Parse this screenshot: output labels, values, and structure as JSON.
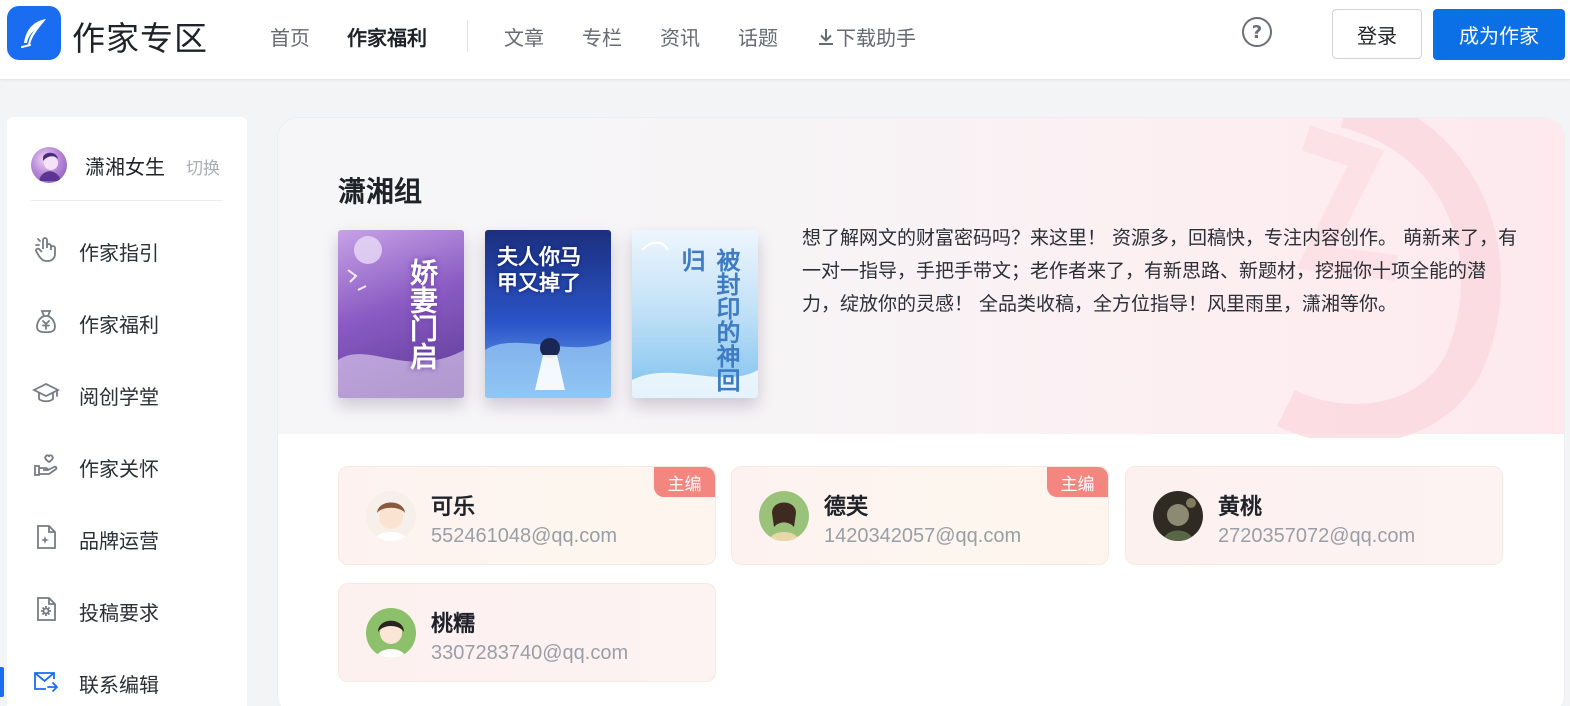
{
  "header": {
    "site_name": "作家专区",
    "nav": [
      {
        "label": "首页",
        "active": false
      },
      {
        "label": "作家福利",
        "active": true
      },
      {
        "label": "文章",
        "active": false
      },
      {
        "label": "专栏",
        "active": false
      },
      {
        "label": "资讯",
        "active": false
      },
      {
        "label": "话题",
        "active": false
      },
      {
        "label": "下载助手",
        "active": false
      }
    ],
    "help_symbol": "?",
    "login_label": "登录",
    "become_author_label": "成为作家"
  },
  "sidebar": {
    "channel_name": "潇湘女生",
    "switch_label": "切换",
    "items": [
      {
        "label": "作家指引",
        "icon": "pointer-hand-icon",
        "active": false
      },
      {
        "label": "作家福利",
        "icon": "money-bag-icon",
        "active": false
      },
      {
        "label": "阅创学堂",
        "icon": "graduation-cap-icon",
        "active": false
      },
      {
        "label": "作家关怀",
        "icon": "care-hand-icon",
        "active": false
      },
      {
        "label": "品牌运营",
        "icon": "document-sparkle-icon",
        "active": false
      },
      {
        "label": "投稿要求",
        "icon": "document-gear-icon",
        "active": false
      },
      {
        "label": "联系编辑",
        "icon": "mail-forward-icon",
        "active": true
      }
    ]
  },
  "main": {
    "group_title": "潇湘组",
    "intro": "想了解网文的财富密码吗？来这里！ 资源多，回稿快，专注内容创作。 萌新来了，有一对一指导，手把手带文；老作者来了，有新思路、新题材，挖掘你十项全能的潜力，绽放你的灵感！ 全品类收稿，全方位指导！风里雨里，潇湘等你。",
    "books": [
      {
        "cover_title": "娇妻门启"
      },
      {
        "cover_title": "夫人你马甲又掉了"
      },
      {
        "cover_title": "被封印的神回归"
      }
    ],
    "editors": [
      {
        "name": "可乐",
        "email": "552461048@qq.com",
        "badge": "主编"
      },
      {
        "name": "德芙",
        "email": "1420342057@qq.com",
        "badge": "主编"
      },
      {
        "name": "黄桃",
        "email": "2720357072@qq.com",
        "badge": ""
      },
      {
        "name": "桃糯",
        "email": "3307283740@qq.com",
        "badge": ""
      }
    ]
  },
  "colors": {
    "primary": "#0b6fe6",
    "badge": "#f3867f",
    "editor_card_bg": "#fdf2f0"
  }
}
